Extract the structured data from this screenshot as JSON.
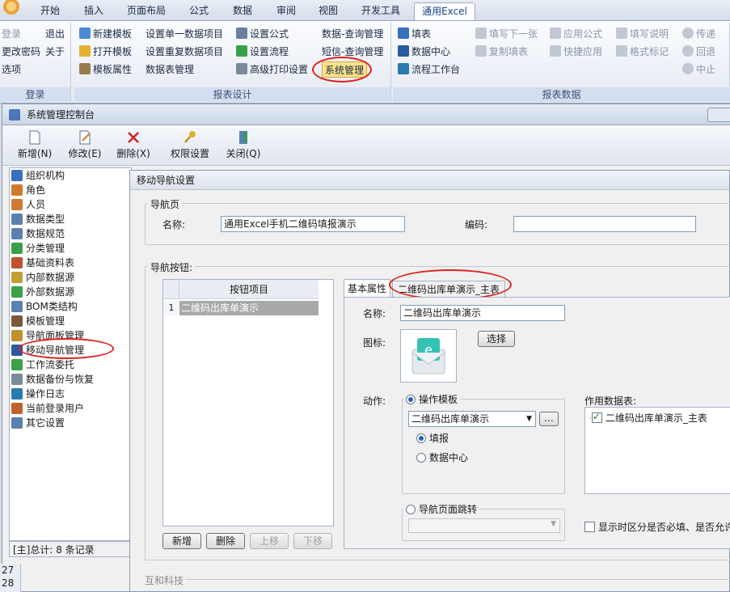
{
  "ribbon": {
    "tabs": [
      "开始",
      "插入",
      "页面布局",
      "公式",
      "数据",
      "审阅",
      "视图",
      "开发工具",
      "通用Excel"
    ],
    "active_tab": "通用Excel",
    "group_login": {
      "label": "登录",
      "items": [
        "登录",
        "退出",
        "更改密码",
        "关于",
        "选项"
      ]
    },
    "group_design": {
      "label": "报表设计",
      "col1": [
        "新建模板",
        "打开模板",
        "模板属性"
      ],
      "col2": [
        "设置单一数据项目",
        "设置重复数据项目",
        "数据表管理"
      ],
      "col3": [
        "设置公式",
        "设置流程",
        "高级打印设置"
      ],
      "col4": [
        "数据-查询管理",
        "短信-查询管理",
        "系统管理"
      ]
    },
    "group_data": {
      "label": "报表数据",
      "col1": [
        "填表",
        "数据中心",
        "流程工作台"
      ],
      "col2": [
        "填写下一张",
        "复制填表"
      ],
      "col3": [
        "应用公式",
        "快捷应用"
      ],
      "col4": [
        "填写说明",
        "格式标记"
      ],
      "col5": [
        "传递",
        "回退",
        "中止"
      ]
    }
  },
  "console": {
    "title": "系统管理控制台",
    "toolbar": [
      "新增(N)",
      "修改(E)",
      "删除(X)",
      "权限设置",
      "关闭(Q)"
    ],
    "tree": [
      "组织机构",
      "角色",
      "人员",
      "数据类型",
      "数据规范",
      "分类管理",
      "基础资料表",
      "内部数据源",
      "外部数据源",
      "BOM类结构",
      "模板管理",
      "导航面板管理",
      "移动导航管理",
      "工作流委托",
      "数据备份与恢复",
      "操作日志",
      "当前登录用户",
      "其它设置"
    ],
    "status": "[主]总计: 8 条记录"
  },
  "dialog": {
    "title": "移动导航设置",
    "nav_page_legend": "导航页",
    "name_label": "名称:",
    "name_value": "通用Excel手机二维码填报演示",
    "code_label": "编码:",
    "code_value": "",
    "nav_buttons_legend": "导航按钮:",
    "grid_header": "按钮项目",
    "grid_rows": [
      {
        "num": "1",
        "text": "二维码出库单演示"
      }
    ],
    "grid_buttons": [
      "新增",
      "删除",
      "上移",
      "下移"
    ],
    "tabs": [
      "基本属性",
      "二维码出库单演示_主表"
    ],
    "detail_name_label": "名称:",
    "detail_name_value": "二维码出库单演示",
    "icon_label": "图标:",
    "select_button": "选择",
    "action_label": "动作:",
    "action_option1": "操作模板",
    "template_value": "二维码出库单演示",
    "browse_button": "...",
    "sub_option1": "填报",
    "sub_option2": "数据中心",
    "action_option2": "导航页面跳转",
    "datatable_label": "作用数据表:",
    "datatable_item": "二维码出库单演示_主表",
    "show_required": "显示时区分是否必填、是否允许",
    "footer": "互和科技"
  },
  "row_numbers": [
    "27",
    "28"
  ]
}
